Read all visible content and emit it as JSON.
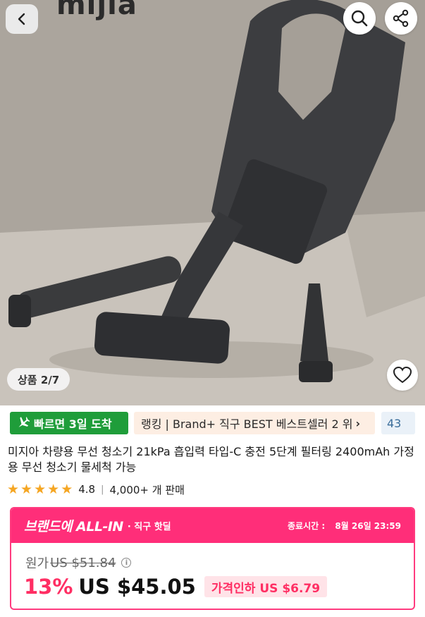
{
  "hero": {
    "brand_logo": "mijia",
    "image_counter": "상품 2/7",
    "icons": [
      "back-icon",
      "search-icon",
      "share-icon",
      "heart-icon"
    ]
  },
  "badges": {
    "fast_delivery": "빠르면 3일 도착",
    "ranking": "랭킹 | Brand+ 직구 BEST 베스트셀러 2 위",
    "count": "43"
  },
  "product": {
    "title": "미지아 차량용 무선 청소기 21kPa 흡입력 타입-C 충전 5단계 필터링 2400mAh 가정용 무선 청소기 물세척 가능",
    "rating": "4.8",
    "rating_stars": 5,
    "sold": "4,000+ 개 판매"
  },
  "deal": {
    "brand_label": "브랜드에 ALL-IN",
    "sub_label": "· 직구 핫딜",
    "end_label": "종료시간 :",
    "end_time": "8월 26일 23:59",
    "original_label": "원가",
    "original_price": "US $51.84",
    "discount": "13%",
    "price": "US $45.05",
    "price_drop": "가격인하 US $6.79"
  },
  "colors": {
    "accent_pink": "#ff2e79",
    "discount_red": "#ff2e63",
    "fast_green": "#1f9d3a",
    "star": "#f5a623"
  }
}
